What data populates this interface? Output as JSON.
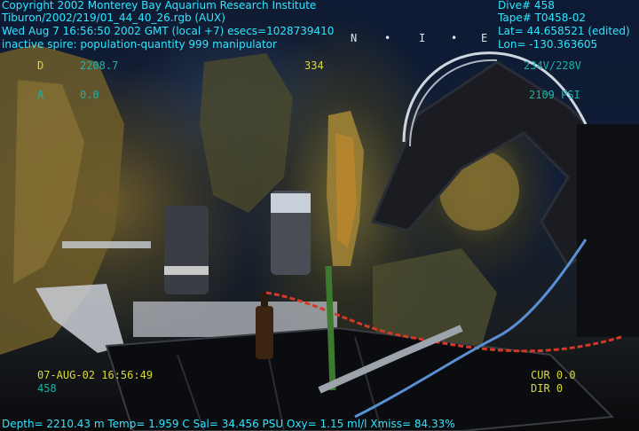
{
  "header_left": {
    "copyright": "Copyright 2002 Monterey Bay Aquarium Research Institute",
    "file": "Tiburon/2002/219/01_44_40_26.rgb (AUX)",
    "datetime": "Wed Aug  7 16:56:50 2002 GMT (local +7)  esecs=1028739410",
    "status": "inactive spire: population-quantity 999 manipulator"
  },
  "header_right": {
    "dive": "Dive# 458",
    "tape": "Tape# T0458-02",
    "lat": "Lat= 44.658521 (edited)",
    "lon": "Lon= -130.363605"
  },
  "compass": [
    "N",
    "•",
    "I",
    "•",
    "E"
  ],
  "telemetry": {
    "d_label": "D",
    "d_value": "2208.7",
    "a_label": "A",
    "a_value": "0.0",
    "mid_value": "334",
    "voltage": "234V/228V",
    "pressure": "2109 PSI"
  },
  "lower_left": {
    "date_time": "07-AUG-02 16:56:49",
    "dive_number": "458"
  },
  "lower_right": {
    "cur": "CUR 0.0",
    "dir": "DIR 0"
  },
  "footer": {
    "ctd": "Depth= 2210.43 m  Temp= 1.959 C  Sal= 34.456 PSU  Oxy= 1.15 ml/l  Xmiss= 84.33%"
  },
  "colors": {
    "overlay_cyan": "#2ee6ff",
    "overlay_yellow": "#d9d93a",
    "overlay_teal": "#19b3a8"
  }
}
